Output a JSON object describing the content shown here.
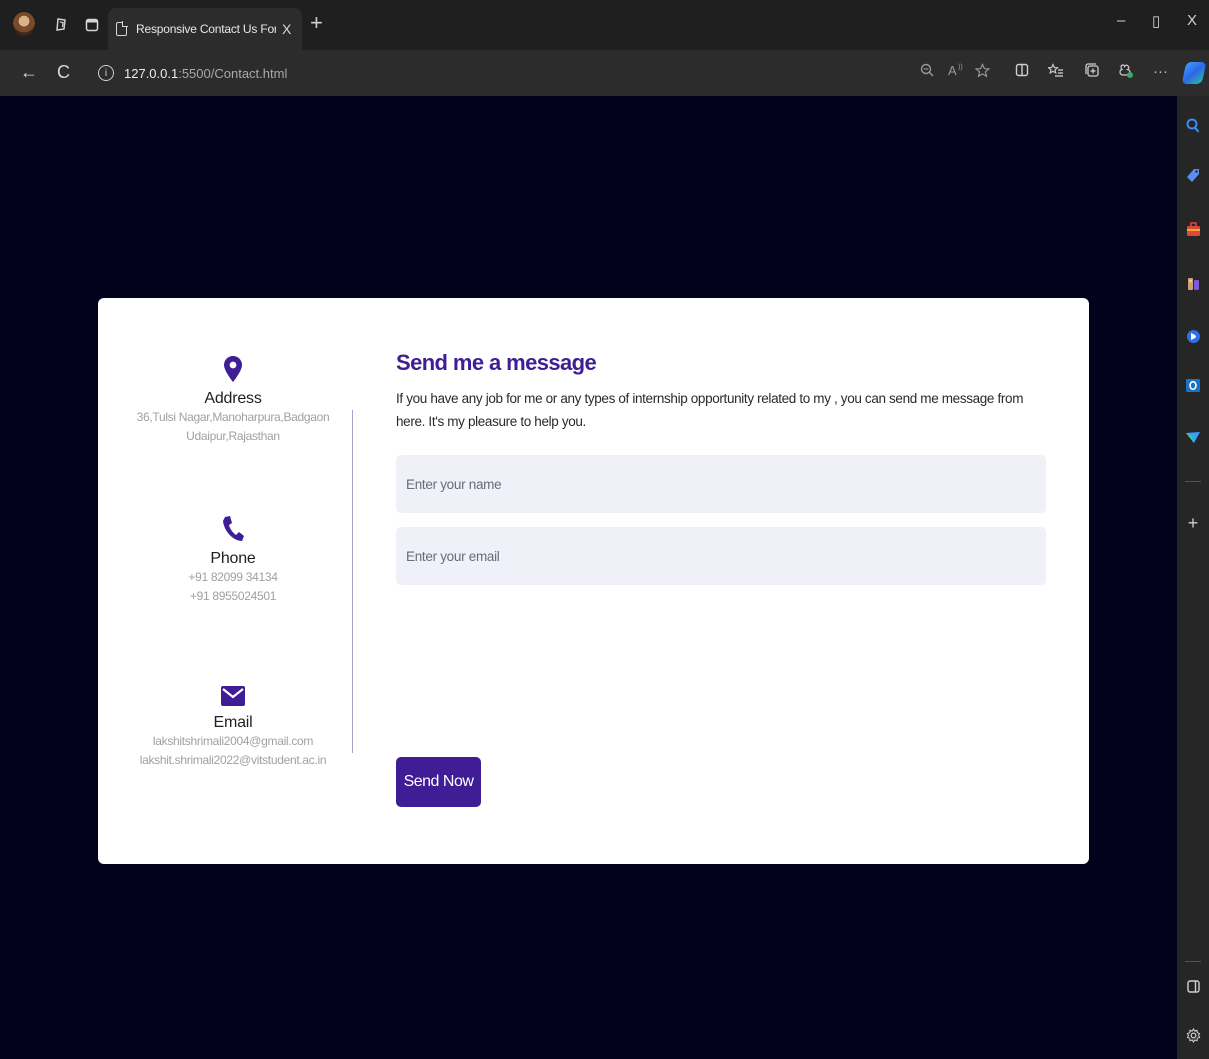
{
  "browser": {
    "tab_title": "Responsive Contact Us Form | Co",
    "tab_close": "X",
    "new_tab": "+",
    "url_host": "127.0.0.1",
    "url_path": ":5500/Contact.html",
    "info_glyph": "i",
    "window_controls": {
      "minimize": "–",
      "restore": "▯",
      "close": "X"
    },
    "nav": {
      "back": "←",
      "reload": "C"
    },
    "toolbar_icons": [
      "zoom-icon",
      "read-aloud-icon",
      "favorite-icon",
      "split-screen-icon",
      "favorites-list-icon",
      "collections-icon",
      "extensions-icon",
      "more-icon"
    ],
    "more_label": "···",
    "sidebar_icons": [
      "search-icon",
      "shopping-icon",
      "tools-icon",
      "games-icon",
      "copilot-icon",
      "outlook-icon",
      "drop-icon",
      "add-icon",
      "sidebar-toggle-icon",
      "settings-icon"
    ],
    "accent": "#3e1d95"
  },
  "contact_info": {
    "address": {
      "heading": "Address",
      "line1": "36,Tulsi Nagar,Manoharpura,Badgaon",
      "line2": "Udaipur,Rajasthan",
      "icon": "location-pin-icon"
    },
    "phone": {
      "heading": "Phone",
      "line1": "+91 82099 34134",
      "line2": "+91 8955024501",
      "icon": "phone-icon"
    },
    "email": {
      "heading": "Email",
      "line1": "lakshitshrimali2004@gmail.com",
      "line2": "lakshit.shrimali2022@vitstudent.ac.in",
      "icon": "envelope-icon"
    }
  },
  "form": {
    "title": "Send me a message",
    "description": "If you have any job for me or any types of internship opportunity related to my , you can send me message from here. It's my pleasure to help you.",
    "name_placeholder": "Enter your name",
    "email_placeholder": "Enter your email",
    "submit_label": "Send Now"
  },
  "colors": {
    "page_background": "#02021c",
    "card_background": "#ffffff",
    "field_background": "#f0f0f8",
    "primary": "#3e1d95"
  }
}
